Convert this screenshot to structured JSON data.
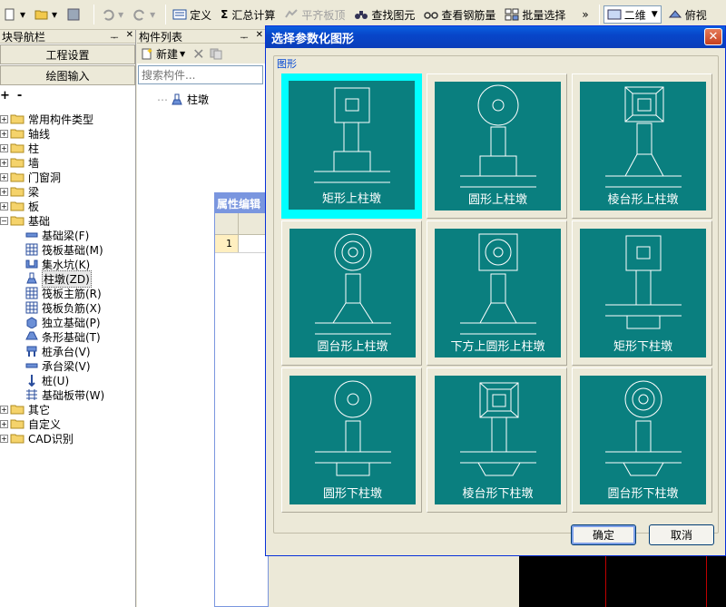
{
  "toolbar": {
    "define": "定义",
    "sum_calc": "汇总计算",
    "flat_top": "平齐板顶",
    "find_element": "查找图元",
    "view_rebar": "查看钢筋量",
    "batch_select": "批量选择",
    "more": "»",
    "view_mode": "二维",
    "view_angle": "俯视"
  },
  "nav": {
    "title": "模块导航栏",
    "title_visible": "块导航栏",
    "project_settings": "工程设置",
    "drawing_input": "绘图输入",
    "tree": [
      {
        "label": "常用构件类型",
        "level": 0,
        "expanded": false
      },
      {
        "label": "轴线",
        "level": 0,
        "expanded": false
      },
      {
        "label": "柱",
        "level": 0,
        "expanded": false
      },
      {
        "label": "墙",
        "level": 0,
        "expanded": false
      },
      {
        "label": "门窗洞",
        "level": 0,
        "expanded": false
      },
      {
        "label": "梁",
        "level": 0,
        "expanded": false
      },
      {
        "label": "板",
        "level": 0,
        "expanded": false
      },
      {
        "label": "基础",
        "level": 0,
        "expanded": true
      },
      {
        "label": "基础梁(F)",
        "level": 1
      },
      {
        "label": "筏板基础(M)",
        "level": 1
      },
      {
        "label": "集水坑(K)",
        "level": 1
      },
      {
        "label": "柱墩(ZD)",
        "level": 1,
        "selected": true
      },
      {
        "label": "筏板主筋(R)",
        "level": 1
      },
      {
        "label": "筏板负筋(X)",
        "level": 1
      },
      {
        "label": "独立基础(P)",
        "level": 1
      },
      {
        "label": "条形基础(T)",
        "level": 1
      },
      {
        "label": "桩承台(V)",
        "level": 1
      },
      {
        "label": "承台梁(V)",
        "level": 1
      },
      {
        "label": "桩(U)",
        "level": 1
      },
      {
        "label": "基础板带(W)",
        "level": 1
      },
      {
        "label": "其它",
        "level": 0,
        "expanded": false
      },
      {
        "label": "自定义",
        "level": 0,
        "expanded": false
      },
      {
        "label": "CAD识别",
        "level": 0,
        "expanded": false
      }
    ]
  },
  "clist": {
    "title": "构件列表",
    "new_label": "新建",
    "search_placeholder": "搜索构件...",
    "item": "柱墩"
  },
  "prop": {
    "title": "属性编辑",
    "row1": "1"
  },
  "dialog": {
    "title": "选择参数化图形",
    "group": "图形",
    "options": [
      {
        "label": "矩形上柱墩",
        "selected": true
      },
      {
        "label": "圆形上柱墩"
      },
      {
        "label": "棱台形上柱墩"
      },
      {
        "label": "圆台形上柱墩"
      },
      {
        "label": "下方上圆形上柱墩"
      },
      {
        "label": "矩形下柱墩"
      },
      {
        "label": "圆形下柱墩"
      },
      {
        "label": "棱台形下柱墩"
      },
      {
        "label": "圆台形下柱墩"
      }
    ],
    "ok": "确定",
    "cancel": "取消"
  },
  "colors": {
    "tile_bg": "#0a7f7f",
    "selected_border": "#00ffff",
    "title_bar": "#0846c9"
  }
}
